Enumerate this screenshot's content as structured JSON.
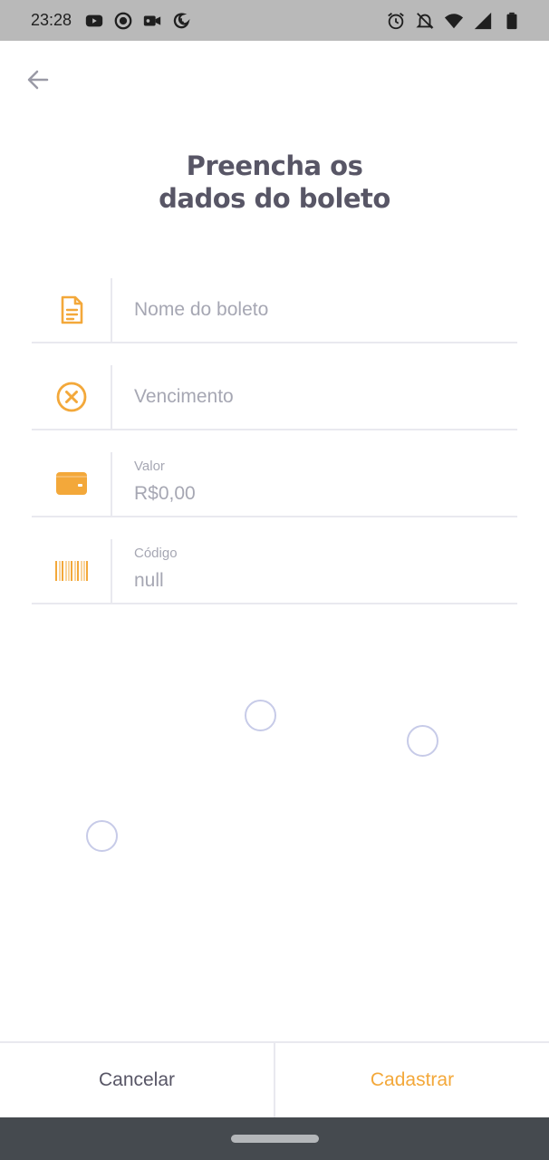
{
  "status_bar": {
    "time": "23:28",
    "left_icons": [
      "youtube-icon",
      "record-icon",
      "video-camera-icon",
      "moon-alarm-icon"
    ],
    "right_icons": [
      "alarm-clock-icon",
      "notifications-off-icon",
      "wifi-icon",
      "signal-icon",
      "battery-icon"
    ]
  },
  "header": {
    "back_icon": "arrow-left-icon",
    "title_line1": "Preencha os",
    "title_line2": "dados do boleto"
  },
  "form": {
    "name": {
      "icon": "document-icon",
      "placeholder": "Nome do boleto"
    },
    "due_date": {
      "icon": "close-circle-icon",
      "placeholder": "Vencimento"
    },
    "amount": {
      "icon": "wallet-icon",
      "label": "Valor",
      "value": "R$0,00"
    },
    "code": {
      "icon": "barcode-icon",
      "label": "Código",
      "value": "null"
    }
  },
  "footer": {
    "cancel_label": "Cancelar",
    "submit_label": "Cadastrar"
  },
  "colors": {
    "accent": "#f3a83a",
    "title": "#585666",
    "placeholder": "#a6a7b3",
    "divider": "#e9e9ef",
    "status_bar": "#b9b9b9",
    "nav_bar": "#454a4f"
  }
}
